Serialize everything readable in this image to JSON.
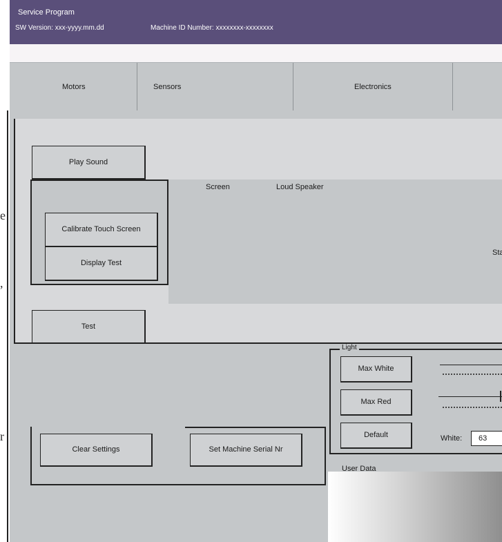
{
  "header": {
    "title": "Service Program",
    "sw_version": "SW Version: xxx-yyyy.mm.dd",
    "machine_id": "Machine ID Number: xxxxxxxx-xxxxxxxx"
  },
  "tabs": [
    {
      "label": "Motors"
    },
    {
      "label": "Sensors"
    },
    {
      "label": "Electronics"
    }
  ],
  "buttons": {
    "play_sound": "Play Sound",
    "calibrate_touch": "Calibrate Touch Screen",
    "display_test": "Display Test",
    "test": "Test",
    "clear_settings": "Clear Settings",
    "set_serial": "Set Machine Serial Nr",
    "max_white": "Max White",
    "max_red": "Max Red",
    "default": "Default"
  },
  "labels": {
    "screen": "Screen",
    "loud_speaker": "Loud Speaker",
    "status_partial": "Sta",
    "light_group": "Light",
    "white_label": "White:",
    "user_data": "User Data"
  },
  "inputs": {
    "white_value": "63"
  },
  "left_edge_glyphs": [
    "e",
    ",",
    "r"
  ],
  "colors": {
    "titlebar": "#5a4f7a",
    "panel": "#c4c7c9",
    "panel_light": "#d8d9db"
  }
}
